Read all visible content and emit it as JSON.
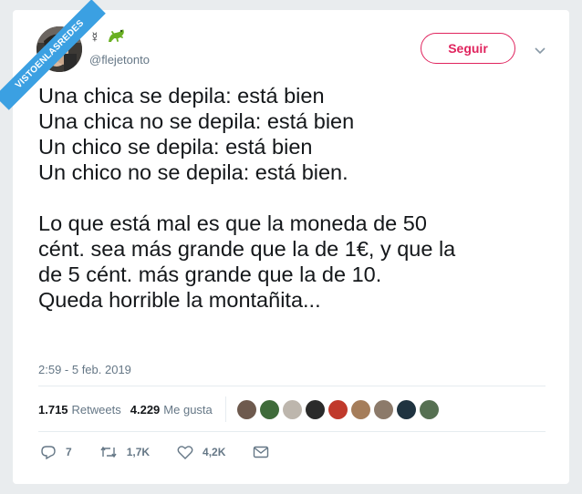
{
  "watermark": "VISTOENLASREDES",
  "user": {
    "name_symbol": "☿",
    "name_icon": "gecko-icon",
    "handle": "@flejetonto"
  },
  "follow_button": "Seguir",
  "tweet": {
    "lines": [
      "Una chica se depila: está bien",
      "Una chica no se depila: está bien",
      "Un chico se depila: está bien",
      "Un chico no se depila: está bien.",
      "",
      "Lo que está mal es que la moneda de 50",
      "cént. sea más grande que la de 1€, y que la",
      "de 5 cént. más grande que la de 10.",
      "Queda horrible la montañita..."
    ],
    "timestamp": "2:59 - 5 feb. 2019"
  },
  "stats": {
    "retweets_count": "1.715",
    "retweets_label": "Retweets",
    "likes_count": "4.229",
    "likes_label": "Me gusta"
  },
  "liker_colors": [
    "#6e5a4e",
    "#3f6b3a",
    "#bdb6ad",
    "#2a2a2a",
    "#c0392b",
    "#a57d5a",
    "#8c7a6a",
    "#1f3340",
    "#567052"
  ],
  "actions": {
    "replies": "7",
    "retweets": "1,7K",
    "likes": "4,2K"
  },
  "colors": {
    "follow": "#e0245e",
    "ribbon": "#3ba0e2",
    "gecko": "#6ab023"
  }
}
